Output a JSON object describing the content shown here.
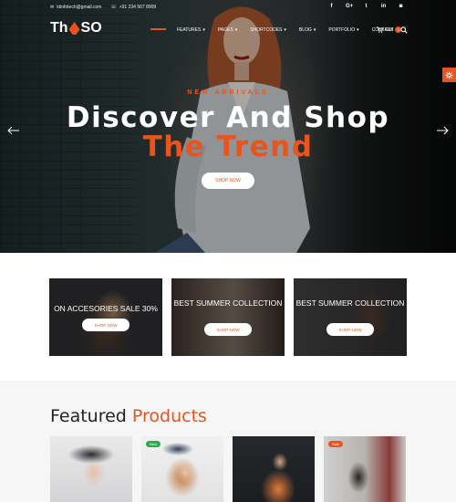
{
  "topbar": {
    "email": "ktinfotech@gmail.com",
    "phone": "+91 234 567 8909",
    "socials": [
      {
        "icon": "facebook-icon",
        "glyph": "f"
      },
      {
        "icon": "google-plus-icon",
        "glyph": "G+"
      },
      {
        "icon": "twitter-icon",
        "glyph": "t"
      },
      {
        "icon": "linkedin-icon",
        "glyph": "in"
      },
      {
        "icon": "instagram-icon",
        "glyph": "◙"
      }
    ]
  },
  "logo": {
    "text_left": "Th",
    "text_right": "SO"
  },
  "nav": {
    "items": [
      {
        "label": "FEATURES"
      },
      {
        "label": "PAGES"
      },
      {
        "label": "SHORTCODES"
      },
      {
        "label": "BLOG"
      },
      {
        "label": "PORTFOLIO"
      },
      {
        "label": "CONTACT"
      }
    ],
    "cart_label": "Cart",
    "cart_count": "0"
  },
  "hero": {
    "kicker": "NEW ARRIVALS",
    "headline_line1": "Discover And Shop",
    "headline_line2": "The Trend",
    "button_label": "SHOP NOW"
  },
  "banners": [
    {
      "title": "ON ACCESORIES SALE 30%",
      "button": "SHOP NOW"
    },
    {
      "title": "BEST SUMMER COLLECTION",
      "button": "SHOP NOW"
    },
    {
      "title": "BEST SUMMER COLLECTION",
      "button": "SHOP NOW"
    }
  ],
  "featured": {
    "title_plain": "Featured",
    "title_accent": "Products",
    "products": [
      {
        "badge": ""
      },
      {
        "badge": "New"
      },
      {
        "badge": ""
      },
      {
        "badge": "Sale"
      }
    ]
  },
  "colors": {
    "accent": "#e8541e",
    "new_badge": "#2eaa4a",
    "sale_badge": "#e8541e"
  }
}
